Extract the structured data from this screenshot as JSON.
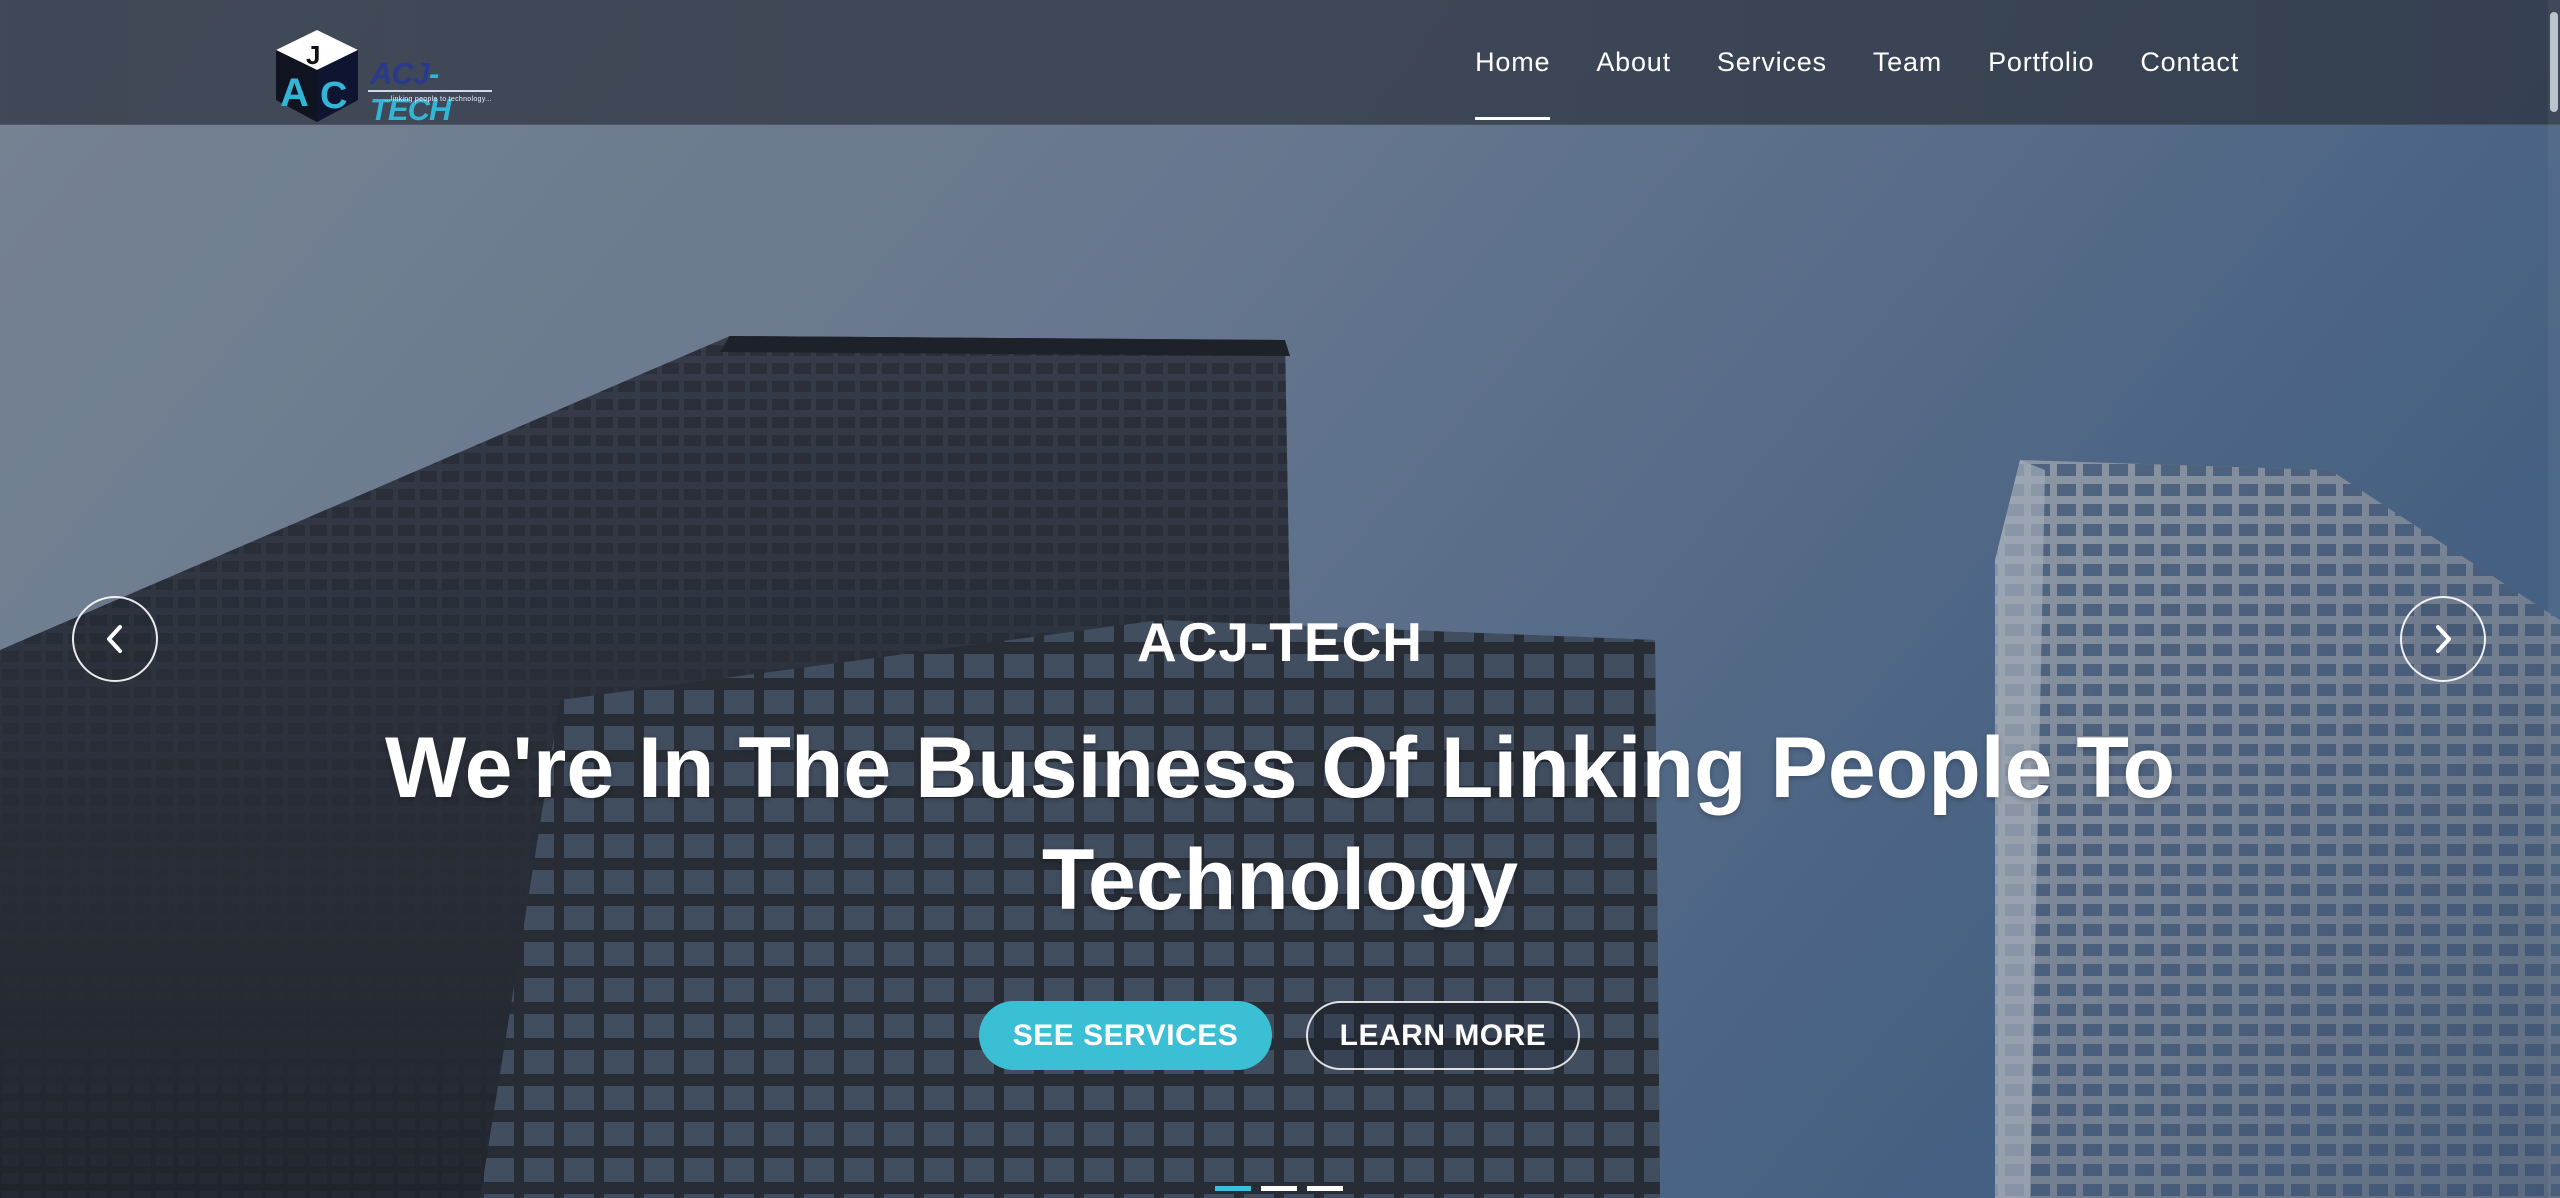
{
  "brand": {
    "name_part1": "ACJ",
    "name_part2": "-TECH",
    "tagline": "...linking people to technology..."
  },
  "nav": {
    "items": [
      {
        "label": "Home",
        "active": true
      },
      {
        "label": "About",
        "active": false
      },
      {
        "label": "Services",
        "active": false
      },
      {
        "label": "Team",
        "active": false
      },
      {
        "label": "Portfolio",
        "active": false
      },
      {
        "label": "Contact",
        "active": false
      }
    ]
  },
  "hero": {
    "kicker": "ACJ-TECH",
    "title": "We're In The Business Of Linking People To Technology",
    "primary_button": "SEE SERVICES",
    "secondary_button": "LEARN MORE",
    "prev_icon": "chevron-left-icon",
    "next_icon": "chevron-right-icon",
    "slide_count": 3,
    "active_slide": 1
  },
  "colors": {
    "accent": "#3bbfd4",
    "header_bg": "#3c4452",
    "logo_blue": "#2a3a8a"
  }
}
